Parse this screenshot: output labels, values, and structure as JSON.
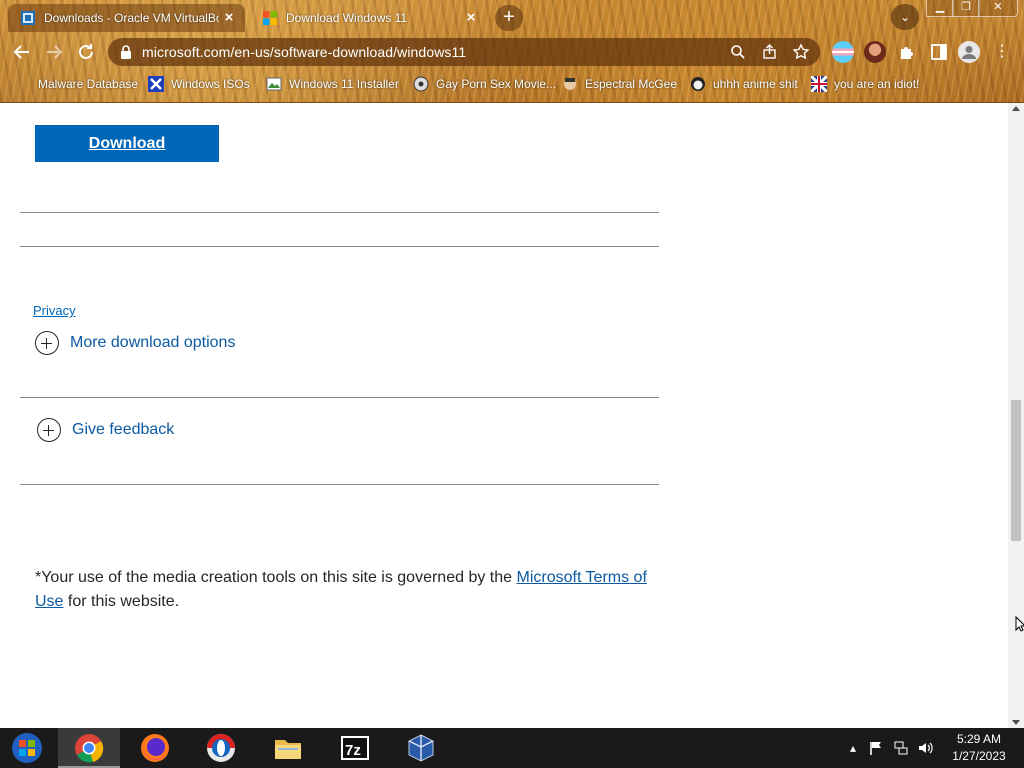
{
  "browser": {
    "tabs": [
      {
        "title": "Downloads - Oracle VM VirtualBox",
        "active": true
      },
      {
        "title": "Download Windows 11",
        "active": false
      }
    ],
    "url": "microsoft.com/en-us/software-download/windows11",
    "bookmarks": [
      {
        "label": "Malware Database"
      },
      {
        "label": "Windows ISOs"
      },
      {
        "label": "Windows 11 Installer"
      },
      {
        "label": "Gay Porn Sex Movie..."
      },
      {
        "label": "Espectral McGee"
      },
      {
        "label": "uhhh anime shit"
      },
      {
        "label": "you are an idiot!"
      }
    ]
  },
  "page": {
    "download_label": "Download",
    "privacy_label": "Privacy",
    "more_options_label": "More download options",
    "feedback_label": "Give feedback",
    "terms_prefix": "*Your use of the media creation tools on this site is governed by the ",
    "terms_link": "Microsoft Terms of Use",
    "terms_suffix": " for this website."
  },
  "taskbar": {
    "apps": [
      "start-button",
      "chrome",
      "firefox",
      "opera",
      "file-explorer",
      "7-zip",
      "virtualbox"
    ],
    "active_app": "chrome",
    "time": "5:29 AM",
    "date": "1/27/2023"
  },
  "colors": {
    "accent": "#0067b8",
    "link": "#0b5aa3",
    "taskbar": "#1a1a1a"
  }
}
